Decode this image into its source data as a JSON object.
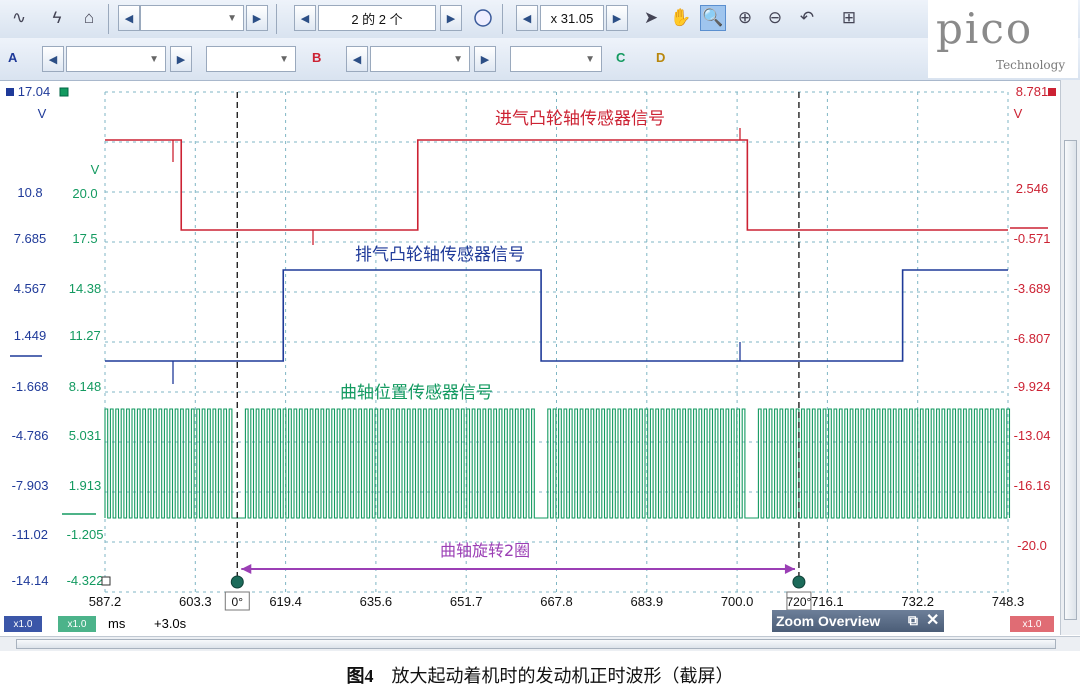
{
  "toolbar1": {
    "page_counter": "2 的 2 个",
    "zoom_value": "x 31.05",
    "icons": [
      "waveform-icon",
      "trigger-icon",
      "home-icon",
      "left-arrow-icon",
      "dropdown-icon",
      "right-arrow-icon",
      "compass-icon",
      "pointer-icon",
      "hand-icon",
      "zoom-select-icon",
      "zoom-in-icon",
      "zoom-out-icon",
      "undo-zoom-icon",
      "zoom-overview-icon"
    ]
  },
  "toolbar2": {
    "channel_a": "A",
    "channel_b": "B",
    "channel_c": "C",
    "channel_d": "D"
  },
  "logo": {
    "brand": "pico",
    "tagline": "Technology"
  },
  "colors": {
    "red": "#cc2233",
    "blue": "#1f3a99",
    "green": "#139a60",
    "purple": "#9b3fb5",
    "grid": "#7fb6c4"
  },
  "chart_data": {
    "type": "line",
    "x_unit": "ms",
    "x_ticks": [
      "587.2",
      "603.3",
      "619.4",
      "635.6",
      "651.7",
      "667.8",
      "683.9",
      "700.0",
      "716.1",
      "732.2",
      "748.3"
    ],
    "x_range": [
      587.2,
      748.3
    ],
    "axis_blue": {
      "unit": "V",
      "top": "17.04",
      "ticks": [
        "10.8",
        "7.685",
        "4.567",
        "1.449",
        "-1.668",
        "-4.786",
        "-7.903",
        "-11.02",
        "-14.14"
      ]
    },
    "axis_green": {
      "unit": "V",
      "ticks": [
        "20.0",
        "17.5",
        "14.38",
        "11.27",
        "8.148",
        "5.031",
        "1.913",
        "-1.205",
        "-4.322"
      ]
    },
    "axis_red": {
      "unit": "V",
      "top": "8.781",
      "ticks": [
        "2.546",
        "-0.571",
        "-3.689",
        "-6.807",
        "-9.924",
        "-13.04",
        "-16.16",
        "-20.0"
      ]
    },
    "series": [
      {
        "name": "进气凸轮轴传感器信号",
        "color": "#cc2233",
        "edges_ms": [
          {
            "x": 587.2,
            "level": "high"
          },
          {
            "x": 600.8,
            "level": "low"
          },
          {
            "x": 643.0,
            "level": "high"
          },
          {
            "x": 701.8,
            "level": "low"
          }
        ]
      },
      {
        "name": "排气凸轮轴传感器信号",
        "color": "#1f3a99",
        "edges_ms": [
          {
            "x": 587.2,
            "level": "low"
          },
          {
            "x": 619.0,
            "level": "high"
          },
          {
            "x": 665.0,
            "level": "low"
          },
          {
            "x": 729.5,
            "level": "high"
          }
        ]
      },
      {
        "name": "曲轴位置传感器信号",
        "color": "#139a60",
        "pulse_train": true,
        "gaps_ms": [
          610.8,
          664.8,
          702.0
        ]
      }
    ],
    "cursors": [
      {
        "x_ms": 610.8,
        "label": "0°"
      },
      {
        "x_ms": 711.0,
        "label": "720°"
      }
    ],
    "annotation": "曲轴旋转2圈"
  },
  "bottom": {
    "a_scale": "x1.0",
    "b_scale": "x1.0",
    "unit": "ms",
    "offset": "+3.0s",
    "r_scale": "x1.0"
  },
  "zoom_overview": {
    "title": "Zoom Overview"
  },
  "caption": {
    "figure": "图4",
    "text": "放大起动着机时的发动机正时波形（截屏）"
  }
}
